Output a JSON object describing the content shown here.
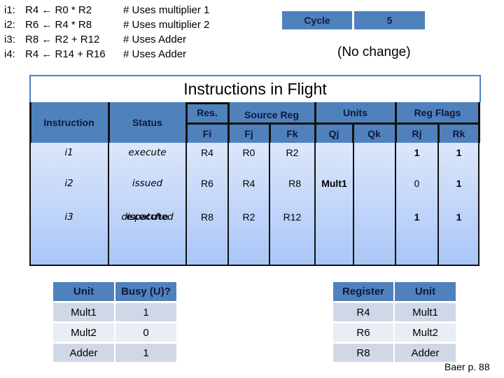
{
  "instructions": [
    {
      "label": "i1:",
      "code": "R4 ← R0 * R2",
      "comment": "# Uses multiplier 1"
    },
    {
      "label": "i2:",
      "code": "R6 ← R4 * R8",
      "comment": "#  Uses multiplier 2"
    },
    {
      "label": "i3:",
      "code": "R8 ← R2 + R12",
      "comment": "# Uses Adder"
    },
    {
      "label": "i4:",
      "code": "R4 ← R14 + R16",
      "comment": "# Uses Adder"
    }
  ],
  "cycle": {
    "label": "Cycle",
    "value": "5"
  },
  "change_note": "(No change)",
  "in_flight": {
    "title": "Instructions in Flight",
    "group_headers": {
      "instruction": "Instruction",
      "status": "Status",
      "res": "Res.",
      "source_reg": "Source Reg",
      "units": "Units",
      "reg_flags": "Reg Flags"
    },
    "sub_headers": {
      "fi": "Fi",
      "fj": "Fj",
      "fk": "Fk",
      "qj": "Qj",
      "qk": "Qk",
      "rj": "Rj",
      "rk": "Rk"
    },
    "rows": [
      {
        "instruction": "i1",
        "status": "execute",
        "status_overlay": "",
        "fi": "R4",
        "fj": "R0",
        "fk": "R2",
        "qj": "",
        "qk": "",
        "rj": "1",
        "rk": "1"
      },
      {
        "instruction": "i2",
        "status": "issued",
        "status_overlay": "",
        "fi": "R6",
        "fj": "R4",
        "fk": "R8",
        "qj": "Mult1",
        "qk": "",
        "rj": "0",
        "rk": "1"
      },
      {
        "instruction": "i3",
        "status": "dispatched",
        "status_overlay": "execute",
        "fi": "R8",
        "fj": "R2",
        "fk": "R12",
        "qj": "",
        "qk": "",
        "rj": "1",
        "rk": "1"
      }
    ]
  },
  "unit_status": {
    "headers": [
      "Unit",
      "Busy (U)?"
    ],
    "rows": [
      {
        "unit": "Mult1",
        "busy": "1"
      },
      {
        "unit": "Mult2",
        "busy": "0"
      },
      {
        "unit": "Adder",
        "busy": "1"
      }
    ]
  },
  "register_status": {
    "headers": [
      "Register",
      "Unit"
    ],
    "rows": [
      {
        "register": "R4",
        "unit": "Mult1"
      },
      {
        "register": "R6",
        "unit": "Mult2"
      },
      {
        "register": "R8",
        "unit": "Adder"
      }
    ]
  },
  "footnote": "Baer p. 88",
  "colors": {
    "header_blue": "#4f81bd",
    "row_light": "#d0d8e8",
    "row_lighter": "#e9edf4"
  }
}
